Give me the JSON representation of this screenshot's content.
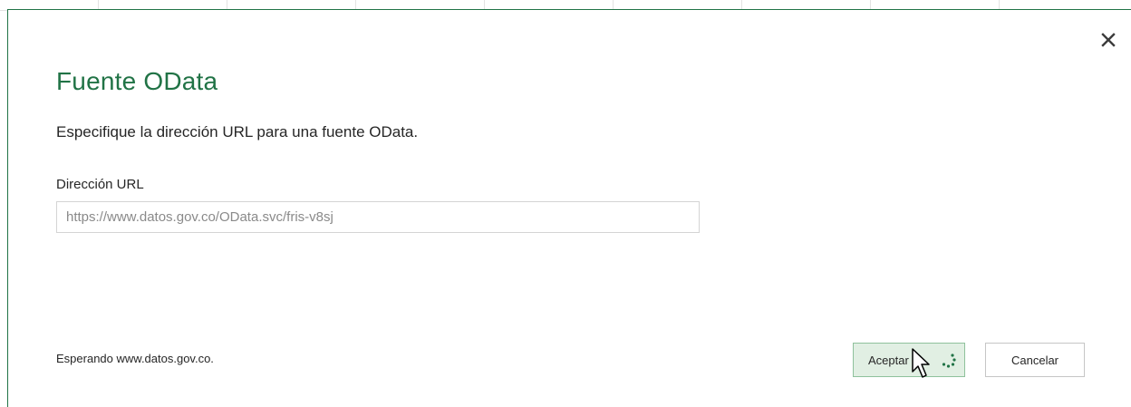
{
  "dialog": {
    "title": "Fuente OData",
    "description": "Especifique la dirección URL para una fuente OData.",
    "url_label": "Dirección URL",
    "url_value": "https://www.datos.gov.co/OData.svc/fris-v8sj",
    "status": "Esperando www.datos.gov.co.",
    "accept_label": "Aceptar",
    "cancel_label": "Cancelar",
    "close_icon": "close-icon"
  },
  "colors": {
    "accent": "#217346",
    "accept_bg": "#e1efe3",
    "accept_border": "#8fc19c"
  }
}
